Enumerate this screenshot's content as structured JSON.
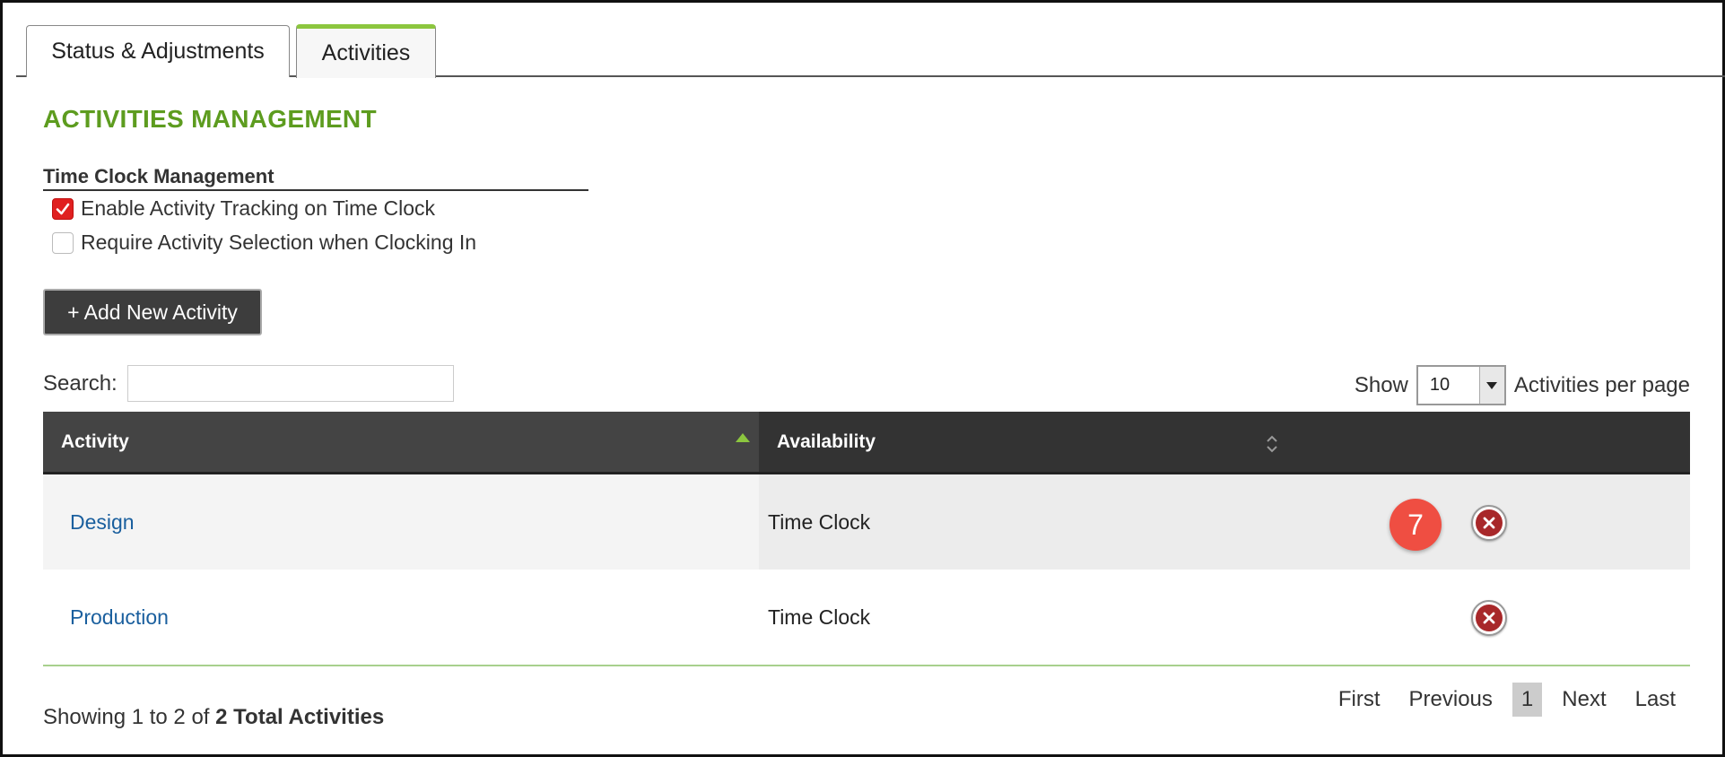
{
  "tabs": [
    {
      "label": "Status & Adjustments",
      "active": false
    },
    {
      "label": "Activities",
      "active": true
    }
  ],
  "section_title": "ACTIVITIES MANAGEMENT",
  "time_clock": {
    "heading": "Time Clock Management",
    "options": [
      {
        "label": "Enable Activity Tracking on Time Clock",
        "checked": true
      },
      {
        "label": "Require Activity Selection when Clocking In",
        "checked": false
      }
    ]
  },
  "add_button_label": "+ Add New Activity",
  "search": {
    "label": "Search:",
    "value": ""
  },
  "per_page": {
    "prefix": "Show",
    "value": "10",
    "suffix": "Activities per page"
  },
  "table": {
    "columns": [
      {
        "label": "Activity",
        "sort": "ascending"
      },
      {
        "label": "Availability",
        "sort": "none"
      }
    ],
    "rows": [
      {
        "activity": "Design",
        "availability": "Time Clock"
      },
      {
        "activity": "Production",
        "availability": "Time Clock"
      }
    ]
  },
  "step_badge": "7",
  "footer": {
    "prefix": "Showing 1 to 2 of ",
    "total": "2 Total Activities"
  },
  "pagination": {
    "first": "First",
    "previous": "Previous",
    "current": "1",
    "next": "Next",
    "last": "Last"
  },
  "colors": {
    "accent_green": "#5d9c1f",
    "header_dark": "#333333",
    "link_blue": "#1a5f9e",
    "delete_red": "#a8282a",
    "badge_red": "#ef4e42"
  }
}
